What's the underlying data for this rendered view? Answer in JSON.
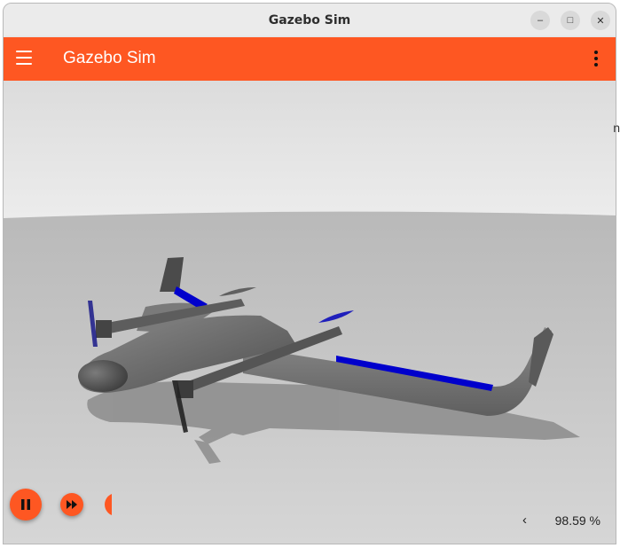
{
  "window": {
    "title": "Gazebo Sim",
    "minimize_icon": "–",
    "maximize_icon": "□",
    "close_icon": "✕"
  },
  "appbar": {
    "title": "Gazebo Sim"
  },
  "controls": {
    "play_pause": "pause-icon",
    "step": "fast-forward-icon"
  },
  "status": {
    "rtf_value": "98.59 %",
    "collapse_icon": "‹"
  },
  "edge_text": "n",
  "colors": {
    "accent": "#fe5722",
    "sky": "#e2e2e2",
    "ground": "#c4c4c4",
    "aircraft": "#6a6a6a",
    "control_surface": "#0000cc"
  }
}
